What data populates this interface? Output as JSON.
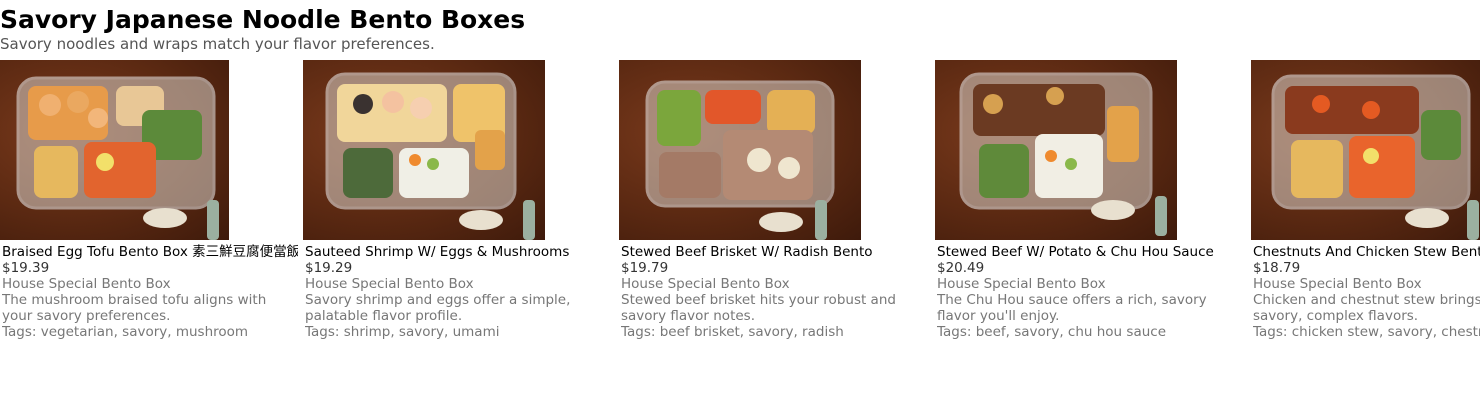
{
  "page": {
    "title": "Savory Japanese Noodle Bento Boxes",
    "subtitle": "Savory noodles and wraps match your flavor preferences."
  },
  "colors": {
    "background": "#ffffff",
    "title": "#000000",
    "muted_text": "#777777",
    "price_text": "#333333",
    "table_wood": "#5b2912"
  },
  "products": [
    {
      "name": "Braised Egg Tofu Bento Box 素三鮮豆腐便當飯",
      "price": "$19.39",
      "category": "House Special Bento Box",
      "description": "The mushroom braised tofu aligns with your savory preferences.",
      "tags_label": "Tags: vegetarian, savory, mushroom",
      "image_icon": "bento-box-photo"
    },
    {
      "name": "Sauteed Shrimp W/ Eggs & Mushrooms",
      "price": "$19.29",
      "category": "House Special Bento Box",
      "description": "Savory shrimp and eggs offer a simple, palatable flavor profile.",
      "tags_label": "Tags: shrimp, savory, umami",
      "image_icon": "bento-box-photo"
    },
    {
      "name": "Stewed Beef Brisket W/ Radish Bento",
      "price": "$19.79",
      "category": "House Special Bento Box",
      "description": "Stewed beef brisket hits your robust and savory flavor notes.",
      "tags_label": "Tags: beef brisket, savory, radish",
      "image_icon": "bento-box-photo"
    },
    {
      "name": "Stewed Beef W/ Potato & Chu Hou Sauce",
      "price": "$20.49",
      "category": "House Special Bento Box",
      "description": "The Chu Hou sauce offers a rich, savory flavor you'll enjoy.",
      "tags_label": "Tags: beef, savory, chu hou sauce",
      "image_icon": "bento-box-photo"
    },
    {
      "name": "Chestnuts And Chicken Stew Bento",
      "price": "$18.79",
      "category": "House Special Bento Box",
      "description": "Chicken and chestnut stew brings rich, savory, complex flavors.",
      "tags_label": "Tags: chicken stew, savory, chestnut",
      "image_icon": "bento-box-photo"
    }
  ]
}
